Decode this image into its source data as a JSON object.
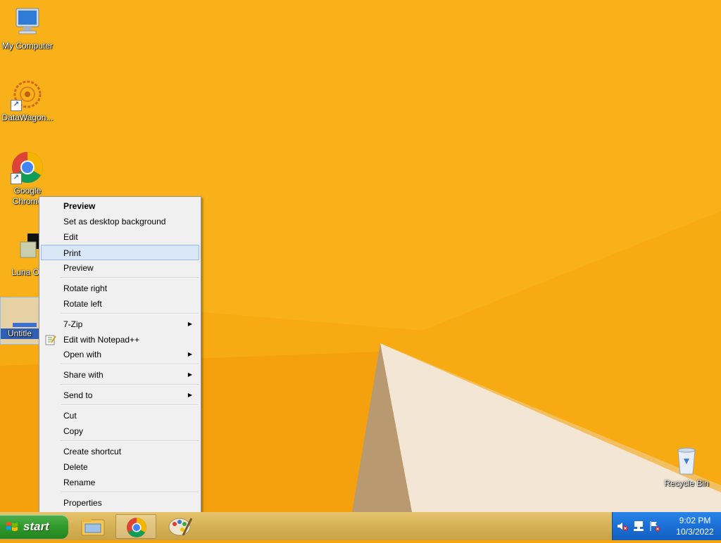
{
  "desktop": {
    "icons": [
      {
        "label": "My Computer"
      },
      {
        "label": "DataWagon..."
      },
      {
        "label": "Google Chrome"
      },
      {
        "label": "Luna Oli"
      },
      {
        "label": "Untitle"
      }
    ],
    "recycle_bin": {
      "label": "Recycle Bin"
    }
  },
  "context_menu": {
    "items": [
      {
        "label": "Preview"
      },
      {
        "label": "Set as desktop background"
      },
      {
        "label": "Edit"
      },
      {
        "label": "Print"
      },
      {
        "label": "Preview"
      },
      {
        "label": "Rotate right"
      },
      {
        "label": "Rotate left"
      },
      {
        "label": "7-Zip"
      },
      {
        "label": "Edit with Notepad++"
      },
      {
        "label": "Open with"
      },
      {
        "label": "Share with"
      },
      {
        "label": "Send to"
      },
      {
        "label": "Cut"
      },
      {
        "label": "Copy"
      },
      {
        "label": "Create shortcut"
      },
      {
        "label": "Delete"
      },
      {
        "label": "Rename"
      },
      {
        "label": "Properties"
      }
    ],
    "highlighted": "Print",
    "highlight_color": "#d9e6f5"
  },
  "taskbar": {
    "start_label": "start",
    "pinned": [
      "file-explorer-icon",
      "chrome-icon",
      "paint-icon"
    ],
    "clock": {
      "time": "9:02 PM",
      "date": "10/3/2022"
    },
    "tray_icons": [
      "volume-muted-icon",
      "network-icon",
      "action-center-flag-icon"
    ]
  },
  "colors": {
    "wallpaper": "#f7a50f",
    "start_green": "#2f9a2c",
    "tray_blue": "#1b6fd6"
  }
}
